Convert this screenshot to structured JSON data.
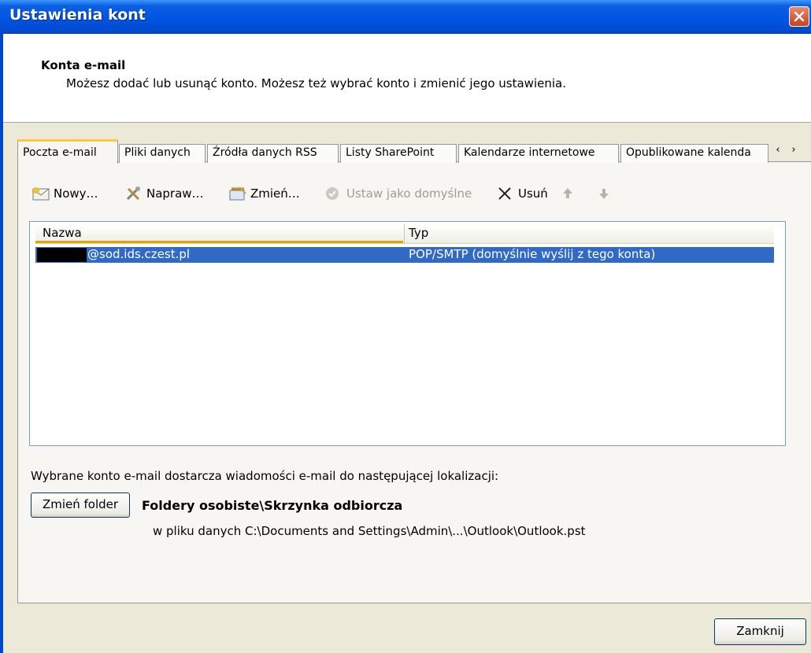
{
  "window": {
    "title": "Ustawienia kont"
  },
  "header": {
    "title": "Konta e-mail",
    "subtitle": "Możesz dodać lub usunąć konto. Możesz też wybrać konto i zmienić jego ustawienia."
  },
  "tabs": [
    {
      "label": "Poczta e-mail",
      "active": true
    },
    {
      "label": "Pliki danych"
    },
    {
      "label": "Źródła danych RSS"
    },
    {
      "label": "Listy SharePoint"
    },
    {
      "label": "Kalendarze internetowe"
    },
    {
      "label": "Opublikowane kalenda"
    }
  ],
  "toolbar": {
    "new_label": "Nowy…",
    "repair_label": "Napraw…",
    "change_label": "Zmień…",
    "default_label": "Ustaw jako domyślne",
    "remove_label": "Usuń"
  },
  "list": {
    "columns": [
      "Nazwa",
      "Typ"
    ],
    "rows": [
      {
        "name": "@sod.ids.czest.pl",
        "type": "POP/SMTP (domyślnie wyślij z tego konta)"
      }
    ]
  },
  "delivery": {
    "label": "Wybrane konto e-mail dostarcza wiadomości e-mail do następującej lokalizacji:",
    "change_folder_label": "Zmień folder",
    "folder": "Foldery osobiste\\Skrzynka odbiorcza",
    "file_path": "w pliku danych C:\\Documents and Settings\\Admin\\...\\Outlook\\Outlook.pst"
  },
  "footer": {
    "close_label": "Zamknij"
  },
  "colors": {
    "titlebar": "#0055e5",
    "selection": "#316ac5",
    "tab_highlight": "#ffc83c"
  }
}
